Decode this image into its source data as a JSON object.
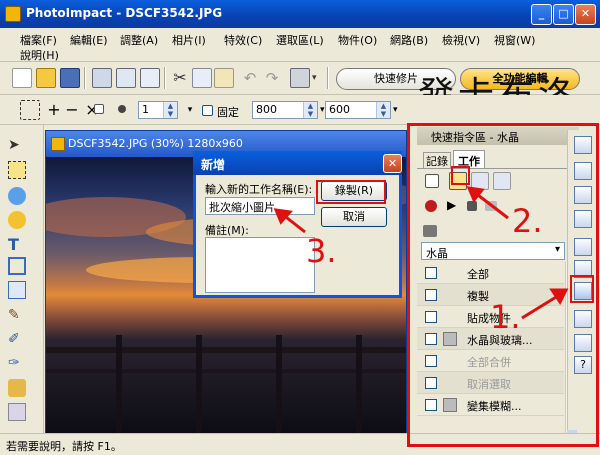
{
  "window": {
    "title": "PhotoImpact - DSCF3542.JPG"
  },
  "menu": {
    "items": [
      "檔案(F)",
      "編輯(E)",
      "調整(A)",
      "相片(I)",
      "特效(C)",
      "選取區(L)",
      "物件(O)",
      "網路(B)",
      "檢視(V)",
      "視窗(W)",
      "說明(H)"
    ]
  },
  "modes": {
    "quick": "快速修片",
    "full": "全功能編輯"
  },
  "toolbar2": {
    "spin_value": "1",
    "fixed_label": "固定",
    "width": "800",
    "height": "600"
  },
  "watermark": "發卡布洛",
  "image_window": {
    "title": "DSCF3542.JPG (30%) 1280x960"
  },
  "dialog": {
    "title": "新增",
    "name_label": "輸入新的工作名稱(E):",
    "name_value": "批次縮小圖片",
    "note_label": "備註(M):",
    "record_button": "錄製(R)",
    "cancel_button": "取消"
  },
  "panel": {
    "title": "快速指令區 - 水晶",
    "tabs": [
      "記錄",
      "工作"
    ],
    "dropdown": "水晶",
    "rows": [
      "全部",
      "複製",
      "貼成物件",
      "水晶與玻璃...",
      "全部合併",
      "取消選取",
      "變集模糊..."
    ]
  },
  "status": {
    "text": "若需要說明，請按 F1。"
  },
  "annotations": {
    "one": "1.",
    "two": "2.",
    "three": "3."
  },
  "colors": {
    "annotation": "#e01010",
    "xp_blue": "#0a5fdc"
  }
}
